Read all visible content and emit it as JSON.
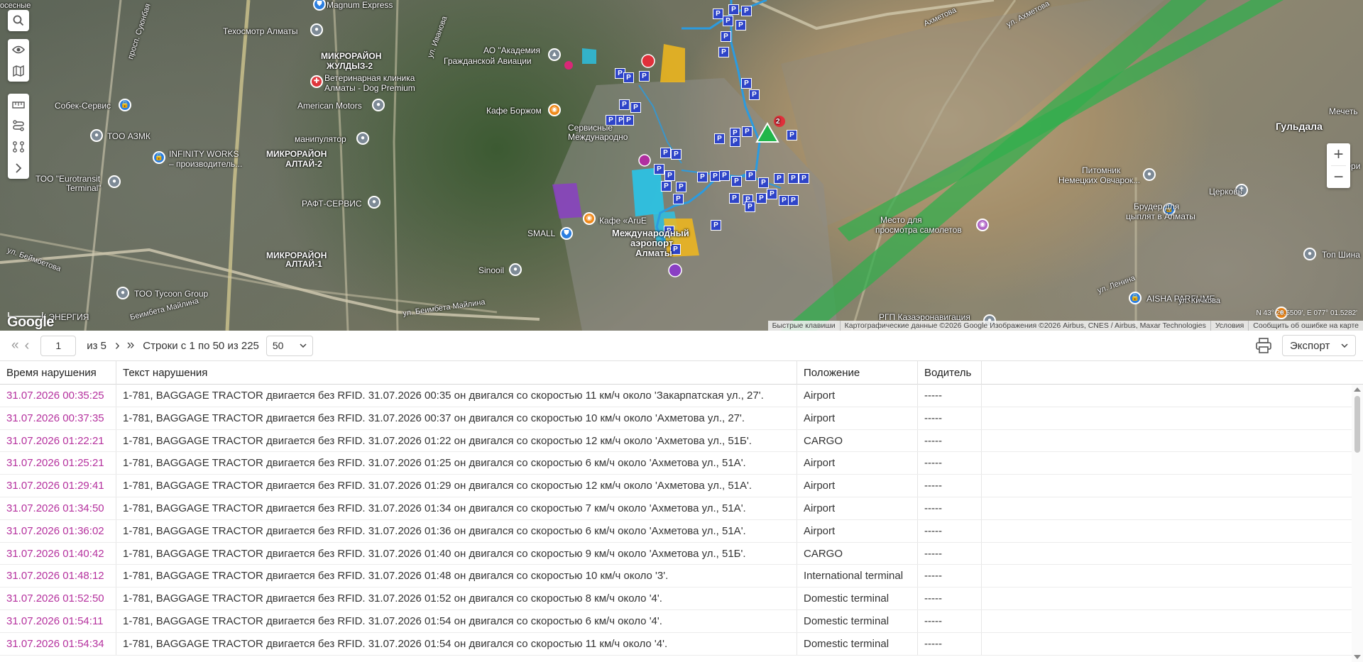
{
  "map": {
    "labels": {
      "magnum": "Magnum Express",
      "tehosmotr": "Техосмотр Алматы",
      "academy_1": "АО \"Академия",
      "academy_2": "Гражданской Авиации",
      "zhuldyz_1": "МИКРОРАЙОН",
      "zhuldyz_2": "ЖУЛДЫЗ-2",
      "vet_1": "Ветеринарная клиника",
      "vet_2": "Алматы - Dog Premium",
      "sobek": "Собек-Сервис",
      "american": "American Motors",
      "borzhom": "Кафе Боржом",
      "asmk": "ТОО АЗМК",
      "manipulator": "манипулятор",
      "altai2_1": "МИКРОРАЙОН",
      "altai2_2": "АЛТАЙ-2",
      "infinity_1": "INFINITY WORKS",
      "infinity_2": "– производитель...",
      "eurotransit_1": "ТОО \"Eurotransit",
      "eurotransit_2": "Terminal\"",
      "raft": "РАФТ-СЕРВИС",
      "service_1": "Сервисные",
      "service_2": "Международно",
      "cafe_aru": "Кафе «АruE",
      "small": "SMALL",
      "intl_1": "Международный",
      "intl_2": "аэропорт",
      "intl_3": "Алматы",
      "sinooil": "Sinooil",
      "altai1_1": "МИКРОРАЙОН",
      "altai1_2": "АЛТАЙ-1",
      "tycoon": "ТОО Tycoon Group",
      "energiya": "К ЭНЕРГИЯ",
      "mesto_1": "Место для",
      "mesto_2": "просмотра самолетов",
      "pitomnik_1": "Питомник",
      "pitomnik_2": "Немецких Овчарок...",
      "gyldala": "Гульдала",
      "tserkov": "Церковь",
      "bruder_1": "Брудер для",
      "bruder_2": "цыплят в Алматы",
      "imperi": "Импери",
      "mechet": "Мечеть",
      "top_shina": "Топ Шина",
      "aisha": "AISHA PARFUME",
      "rgp": "РГП Казаэронавигация",
      "ul_ahmetova_top": "Ахметова",
      "ul_ahmetova_right": "ул. Ахметова",
      "ul_beimbet": "ул. Беимбета Майлина",
      "ul_beimbet_left": "Беимбета Майлина",
      "ul_beimbetova": "ул. Беймбетова",
      "ul_ivanova": "ул. Иванова",
      "ul_lenina": "ул. Ленина",
      "ul_kichkova": "ул. Кичкова",
      "prosp_suyunbai": "просп. Суюнбая",
      "osesnye": "осесные"
    },
    "badge_count": "2",
    "marker_letter": "P",
    "zoom_in": "+",
    "zoom_out": "−",
    "google": "Google",
    "coords": "N 43° 20.5509', E 077° 01.5282'",
    "attribution": {
      "shortcuts": "Быстрые клавиши",
      "mapdata": "Картографические данные ©2026 Google Изображения ©2026 Airbus, CNES / Airbus, Maxar Technologies",
      "terms": "Условия",
      "report": "Сообщить об ошибке на карте"
    },
    "colors": {
      "route": "#2b9be0",
      "runway": "#2fae4c",
      "zone_yellow": "#f2b81c",
      "zone_cyan": "#29c4e8",
      "zone_purple": "#8a3fc4",
      "marker_blue": "#2e44c8",
      "vehicle_green": "#21b64a",
      "badge_red": "#e0303a"
    }
  },
  "pager": {
    "first_icon": "«",
    "prev_icon": "‹",
    "page_value": "1",
    "of_pages": "из 5",
    "next_icon": "›",
    "last_icon": "»",
    "rows_info": "Строки с 1 по 50 из 225",
    "page_size": "50",
    "export_label": "Экспорт"
  },
  "table": {
    "headers": [
      "Время нарушения",
      "Текст нарушения",
      "Положение",
      "Водитель"
    ],
    "rows": [
      {
        "time": "31.07.2026 00:35:25",
        "text": "1-781, BAGGAGE TRACTOR двигается без RFID. 31.07.2026 00:35 он двигался со скоростью 11 км/ч около 'Закарпатская ул., 27'.",
        "location": "Airport",
        "driver": "-----"
      },
      {
        "time": "31.07.2026 00:37:35",
        "text": "1-781, BAGGAGE TRACTOR двигается без RFID. 31.07.2026 00:37 он двигался со скоростью 10 км/ч около 'Ахметова ул., 27'.",
        "location": "Airport",
        "driver": "-----"
      },
      {
        "time": "31.07.2026 01:22:21",
        "text": "1-781, BAGGAGE TRACTOR двигается без RFID. 31.07.2026 01:22 он двигался со скоростью 12 км/ч около 'Ахметова ул., 51Б'.",
        "location": "CARGO",
        "driver": "-----"
      },
      {
        "time": "31.07.2026 01:25:21",
        "text": "1-781, BAGGAGE TRACTOR двигается без RFID. 31.07.2026 01:25 он двигался со скоростью 6 км/ч около 'Ахметова ул., 51А'.",
        "location": "Airport",
        "driver": "-----"
      },
      {
        "time": "31.07.2026 01:29:41",
        "text": "1-781, BAGGAGE TRACTOR двигается без RFID. 31.07.2026 01:29 он двигался со скоростью 12 км/ч около 'Ахметова ул., 51А'.",
        "location": "Airport",
        "driver": "-----"
      },
      {
        "time": "31.07.2026 01:34:50",
        "text": "1-781, BAGGAGE TRACTOR двигается без RFID. 31.07.2026 01:34 он двигался со скоростью 7 км/ч около 'Ахметова ул., 51А'.",
        "location": "Airport",
        "driver": "-----"
      },
      {
        "time": "31.07.2026 01:36:02",
        "text": "1-781, BAGGAGE TRACTOR двигается без RFID. 31.07.2026 01:36 он двигался со скоростью 6 км/ч около 'Ахметова ул., 51А'.",
        "location": "Airport",
        "driver": "-----"
      },
      {
        "time": "31.07.2026 01:40:42",
        "text": "1-781, BAGGAGE TRACTOR двигается без RFID. 31.07.2026 01:40 он двигался со скоростью 9 км/ч около 'Ахметова ул., 51Б'.",
        "location": "CARGO",
        "driver": "-----"
      },
      {
        "time": "31.07.2026 01:48:12",
        "text": "1-781, BAGGAGE TRACTOR двигается без RFID. 31.07.2026 01:48 он двигался со скоростью 10 км/ч около '3'.",
        "location": "International terminal",
        "driver": "-----"
      },
      {
        "time": "31.07.2026 01:52:50",
        "text": "1-781, BAGGAGE TRACTOR двигается без RFID. 31.07.2026 01:52 он двигался со скоростью 8 км/ч около '4'.",
        "location": "Domestic terminal",
        "driver": "-----"
      },
      {
        "time": "31.07.2026 01:54:11",
        "text": "1-781, BAGGAGE TRACTOR двигается без RFID. 31.07.2026 01:54 он двигался со скоростью 6 км/ч около '4'.",
        "location": "Domestic terminal",
        "driver": "-----"
      },
      {
        "time": "31.07.2026 01:54:34",
        "text": "1-781, BAGGAGE TRACTOR двигается без RFID. 31.07.2026 01:54 он двигался со скоростью 11 км/ч около '4'.",
        "location": "Domestic terminal",
        "driver": "-----"
      }
    ]
  }
}
